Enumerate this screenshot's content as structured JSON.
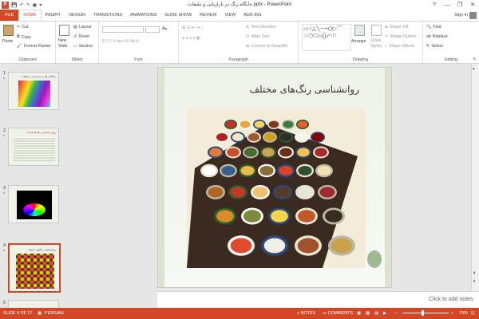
{
  "window": {
    "title": "جایگاه رنگ در بازاریابی و تبلیغات.pptx - PowerPoint",
    "app_icon": "P",
    "controls": [
      "?",
      "—",
      "❐",
      "✕"
    ]
  },
  "tabs": [
    "FILE",
    "HOME",
    "INSERT",
    "DESIGN",
    "TRANSITIONS",
    "ANIMATIONS",
    "SLIDE SHOW",
    "REVIEW",
    "VIEW",
    "ADD-INS"
  ],
  "active_tab": "HOME",
  "account": {
    "signin": "Sign in"
  },
  "ribbon": {
    "clipboard": {
      "label": "Clipboard",
      "paste": "Paste",
      "cut": "Cut",
      "copy": "Copy",
      "format_painter": "Format Painter"
    },
    "slides": {
      "label": "Slides",
      "new_slide_1": "New",
      "new_slide_2": "Slide",
      "layout": "Layout",
      "reset": "Reset",
      "section": "Section"
    },
    "font": {
      "label": "Font"
    },
    "paragraph": {
      "label": "Paragraph",
      "text_direction": "Text Direction",
      "align_text": "Align Text",
      "convert_smartart": "Convert to SmartArt"
    },
    "drawing": {
      "label": "Drawing",
      "arrange": "Arrange",
      "quick_styles_1": "Quick",
      "quick_styles_2": "Styles",
      "shape_fill": "Shape Fill",
      "shape_outline": "Shape Outline",
      "shape_effects": "Shape Effects"
    },
    "editing": {
      "label": "Editing",
      "find": "Find",
      "replace": "Replace",
      "select": "Select"
    }
  },
  "thumbnails": [
    {
      "num": "1",
      "star": "*",
      "title": "جایگاه رنگ در بازاریابی و تبلیغات"
    },
    {
      "num": "2",
      "star": "*",
      "title": "روان شناسی رنگ ها چیست"
    },
    {
      "num": "3",
      "star": "*",
      "title": ""
    },
    {
      "num": "4",
      "star": "*",
      "title": "روانشناسی رنگهای مختلف"
    },
    {
      "num": "5",
      "star": "",
      "title": ""
    }
  ],
  "selected_slide": 4,
  "slide": {
    "title": "روانشناسی رنگ‌های مختلف"
  },
  "notes_placeholder": "Click to add notes",
  "status": {
    "slide_of": "SLIDE 4 OF 27",
    "language": "PERSIAN",
    "notes": "NOTES",
    "comments": "COMMENTS",
    "zoom": "70%"
  },
  "colors": {
    "accent": "#d24726"
  },
  "bowl_colors": [
    "#c9302c",
    "#e8a33d",
    "#f4d35e",
    "#7a3b1e",
    "#3c7a3f",
    "#e85d2a",
    "#b22222",
    "#f0e6c8",
    "#9c5a2c",
    "#d4a017",
    "#2e2e2e",
    "#f5f5f0",
    "#8b0000",
    "#e07b39",
    "#c94f2a",
    "#4a6b2e",
    "#cfa25a",
    "#6b2d1a",
    "#f2c14e",
    "#a52a2a",
    "#ffffff",
    "#3a5f8a",
    "#e9b949",
    "#8a6d3b",
    "#d9442a",
    "#2f4f2f",
    "#f4e1b0",
    "#b5651d",
    "#c0392b",
    "#efc070",
    "#5a3a22",
    "#e6e6d8",
    "#9e2a2b",
    "#d98c2b",
    "#7b8a3c",
    "#f6d54a",
    "#c05a2a",
    "#3b2a20",
    "#e04b2f",
    "#f2f0e6",
    "#a0522d",
    "#caa04a"
  ]
}
